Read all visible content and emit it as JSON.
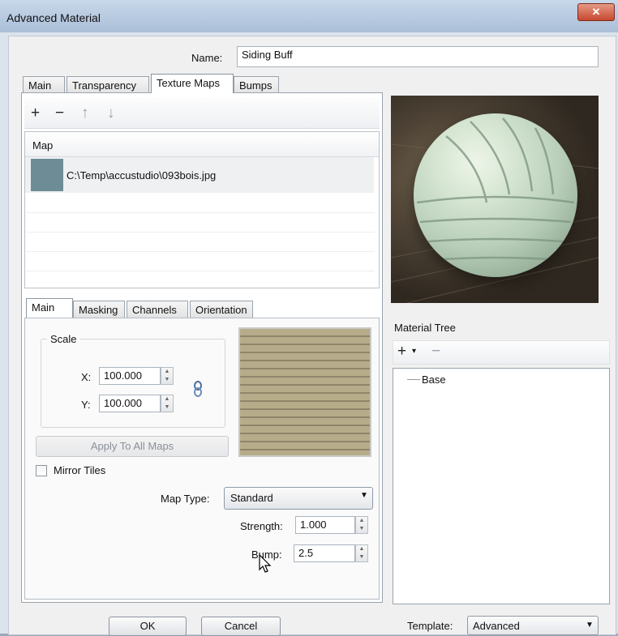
{
  "window": {
    "title": "Advanced Material",
    "close_glyph": "✕"
  },
  "name_field": {
    "label": "Name:",
    "value": "Siding Buff"
  },
  "main_tabs": [
    {
      "label": "Main",
      "active": false
    },
    {
      "label": "Transparency",
      "active": false
    },
    {
      "label": "Texture Maps",
      "active": true
    },
    {
      "label": "Bumps",
      "active": false
    }
  ],
  "map_toolbar": {
    "add_glyph": "+",
    "remove_glyph": "−",
    "up_glyph": "↑",
    "down_glyph": "↓"
  },
  "map_list": {
    "header": "Map",
    "rows": [
      {
        "path": "C:\\Temp\\accustudio\\093bois.jpg",
        "swatch_color": "#6e8c96"
      }
    ]
  },
  "sub_tabs": [
    {
      "label": "Main",
      "active": true
    },
    {
      "label": "Masking",
      "active": false
    },
    {
      "label": "Channels",
      "active": false
    },
    {
      "label": "Orientation",
      "active": false
    }
  ],
  "scale": {
    "group_label": "Scale",
    "x_label": "X:",
    "x_value": "100.000",
    "y_label": "Y:",
    "y_value": "100.000",
    "link_icon": "chain-link-icon"
  },
  "apply_button": "Apply To All Maps",
  "mirror_tiles": {
    "label": "Mirror Tiles",
    "checked": false
  },
  "map_type": {
    "label": "Map Type:",
    "value": "Standard"
  },
  "strength": {
    "label": "Strength:",
    "value": "1.000"
  },
  "bump": {
    "label": "Bump:",
    "value": "2.5"
  },
  "material_tree": {
    "label": "Material Tree",
    "add_glyph": "+",
    "dropdown_glyph": "▾",
    "remove_glyph": "−",
    "items": [
      "Base"
    ]
  },
  "footer": {
    "ok": "OK",
    "cancel": "Cancel",
    "template_label": "Template:",
    "template_value": "Advanced"
  }
}
